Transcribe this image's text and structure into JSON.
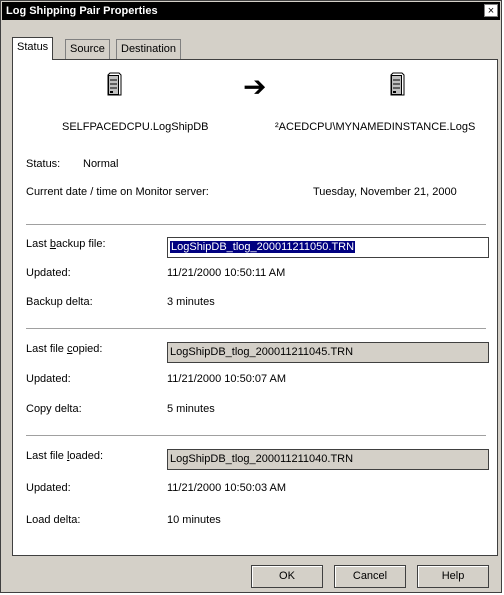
{
  "window": {
    "title": "Log Shipping Pair Properties",
    "close_glyph": "×"
  },
  "tabs": [
    {
      "label": "Status",
      "active": true
    },
    {
      "label": "Source",
      "active": false
    },
    {
      "label": "Destination",
      "active": false
    }
  ],
  "pair": {
    "source_name": "SELFPACEDCPU.LogShipDB",
    "destination_name": "²ACEDCPU\\MYNAMEDINSTANCE.LogS",
    "arrow_glyph": "➔",
    "source_icon": "server-icon",
    "destination_icon": "server-icon"
  },
  "status": {
    "label": "Status:",
    "value": "Normal",
    "datetime_label": "Current date / time on Monitor server:",
    "datetime_value": "Tuesday, November 21, 2000"
  },
  "backup": {
    "file_label_pre": "Last ",
    "file_label_u": "b",
    "file_label_post": "ackup file:",
    "file_value": "LogShipDB_tlog_200011211050.TRN",
    "updated_label": "Updated:",
    "updated_value": "11/21/2000 10:50:11 AM",
    "delta_label": "Backup delta:",
    "delta_value": "3 minutes"
  },
  "copy": {
    "file_label_pre": "Last file ",
    "file_label_u": "c",
    "file_label_post": "opied:",
    "file_value": "LogShipDB_tlog_200011211045.TRN",
    "updated_label": "Updated:",
    "updated_value": "11/21/2000 10:50:07 AM",
    "delta_label": "Copy delta:",
    "delta_value": "5 minutes"
  },
  "load": {
    "file_label_pre": "Last file ",
    "file_label_u": "l",
    "file_label_post": "oaded:",
    "file_value": "LogShipDB_tlog_200011211040.TRN",
    "updated_label": "Updated:",
    "updated_value": "11/21/2000 10:50:03 AM",
    "delta_label": "Load delta:",
    "delta_value": "10 minutes"
  },
  "buttons": {
    "ok": "OK",
    "cancel": "Cancel",
    "help": "Help"
  }
}
